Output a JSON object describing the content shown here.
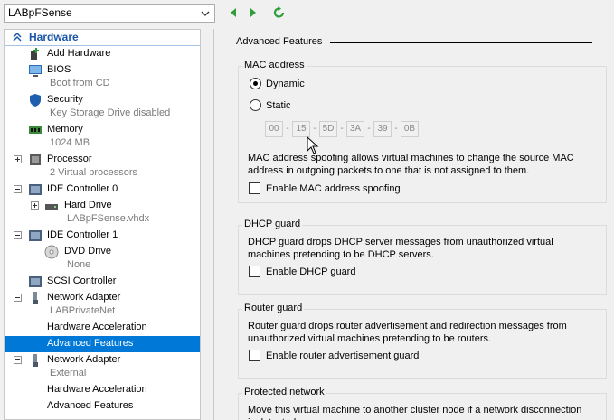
{
  "vm_selector": {
    "value": "LABpFSense"
  },
  "toolbar": {
    "back_icon": "back-arrow-icon",
    "forward_icon": "forward-arrow-icon",
    "refresh_icon": "refresh-icon"
  },
  "tree": {
    "header": "Hardware",
    "items": [
      {
        "label": "Add Hardware"
      },
      {
        "label": "BIOS",
        "sub": "Boot from CD"
      },
      {
        "label": "Security",
        "sub": "Key Storage Drive disabled"
      },
      {
        "label": "Memory",
        "sub": "1024 MB"
      },
      {
        "label": "Processor",
        "sub": "2 Virtual processors"
      },
      {
        "label": "IDE Controller 0"
      },
      {
        "label": "Hard Drive",
        "sub": "LABpFSense.vhdx"
      },
      {
        "label": "IDE Controller 1"
      },
      {
        "label": "DVD Drive",
        "sub": "None"
      },
      {
        "label": "SCSI Controller"
      },
      {
        "label": "Network Adapter",
        "sub": "LABPrivateNet"
      },
      {
        "label": "Hardware Acceleration"
      },
      {
        "label": "Advanced Features"
      },
      {
        "label": "Network Adapter",
        "sub": "External"
      },
      {
        "label": "Hardware Acceleration"
      },
      {
        "label": "Advanced Features"
      }
    ]
  },
  "panel": {
    "title": "Advanced Features",
    "mac": {
      "label": "MAC address",
      "dynamic_label": "Dynamic",
      "static_label": "Static",
      "selected": "Dynamic",
      "octets": [
        "00",
        "15",
        "5D",
        "3A",
        "39",
        "0B"
      ],
      "description": "MAC address spoofing allows virtual machines to change the source MAC address in outgoing packets to one that is not assigned to them.",
      "spoof_label": "Enable MAC address spoofing",
      "spoof_checked": false
    },
    "dhcp": {
      "label": "DHCP guard",
      "description": "DHCP guard drops DHCP server messages from unauthorized virtual machines pretending to be DHCP servers.",
      "checkbox_label": "Enable DHCP guard",
      "checked": false
    },
    "router": {
      "label": "Router guard",
      "description": "Router guard drops router advertisement and redirection messages from unauthorized virtual machines pretending to be routers.",
      "checkbox_label": "Enable router advertisement guard",
      "checked": false
    },
    "protected": {
      "label": "Protected network",
      "description": "Move this virtual machine to another cluster node if a network disconnection is detected."
    }
  },
  "colors": {
    "selection": "#0078d7",
    "header_text": "#1a57a8",
    "nav_green": "#2e9e3a"
  }
}
